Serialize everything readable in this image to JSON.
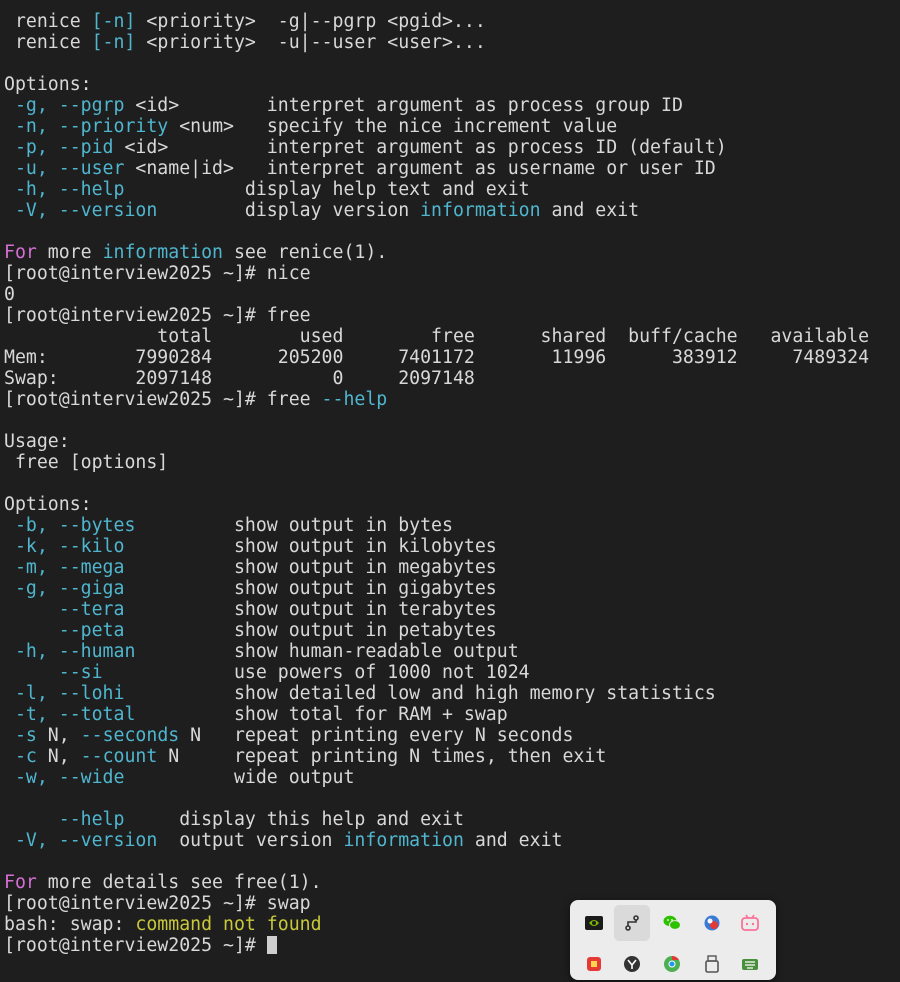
{
  "terminal": {
    "lines": [
      [
        {
          "t": " renice "
        },
        {
          "t": "[-n]",
          "c": "c"
        },
        {
          "t": " <priority>  -g|--pgrp <pgid>..."
        }
      ],
      [
        {
          "t": " renice "
        },
        {
          "t": "[-n]",
          "c": "c"
        },
        {
          "t": " <priority>  -u|--user <user>..."
        }
      ],
      [],
      [
        {
          "t": "Options:"
        }
      ],
      [
        {
          "t": " "
        },
        {
          "t": "-g, --pgrp",
          "c": "c"
        },
        {
          "t": " <id>        interpret argument as process group ID"
        }
      ],
      [
        {
          "t": " "
        },
        {
          "t": "-n, --priority",
          "c": "c"
        },
        {
          "t": " <num>   specify the nice increment value"
        }
      ],
      [
        {
          "t": " "
        },
        {
          "t": "-p, --pid",
          "c": "c"
        },
        {
          "t": " <id>         interpret argument as process ID (default)"
        }
      ],
      [
        {
          "t": " "
        },
        {
          "t": "-u, --user",
          "c": "c"
        },
        {
          "t": " <name|id>   interpret argument as username or user ID"
        }
      ],
      [
        {
          "t": " "
        },
        {
          "t": "-h, --help",
          "c": "c"
        },
        {
          "t": "           display help text and exit"
        }
      ],
      [
        {
          "t": " "
        },
        {
          "t": "-V, --version",
          "c": "c"
        },
        {
          "t": "        display version "
        },
        {
          "t": "information",
          "c": "c"
        },
        {
          "t": " and exit"
        }
      ],
      [],
      [
        {
          "t": "For",
          "c": "m"
        },
        {
          "t": " more "
        },
        {
          "t": "information",
          "c": "c"
        },
        {
          "t": " see renice(1)."
        }
      ],
      [
        {
          "t": "[root@interview2025 ~]# nice"
        }
      ],
      [
        {
          "t": "0"
        }
      ],
      [
        {
          "t": "[root@interview2025 ~]# free"
        }
      ],
      [
        {
          "t": "              total        used        free      shared  buff/cache   available"
        }
      ],
      [
        {
          "t": "Mem:        7990284      205200     7401172       11996      383912     7489324"
        }
      ],
      [
        {
          "t": "Swap:       2097148           0     2097148"
        }
      ],
      [
        {
          "t": "[root@interview2025 ~]# free "
        },
        {
          "t": "--help",
          "c": "c"
        }
      ],
      [],
      [
        {
          "t": "Usage:"
        }
      ],
      [
        {
          "t": " free [options]"
        }
      ],
      [],
      [
        {
          "t": "Options:"
        }
      ],
      [
        {
          "t": " "
        },
        {
          "t": "-b, --bytes",
          "c": "c"
        },
        {
          "t": "         show output in bytes"
        }
      ],
      [
        {
          "t": " "
        },
        {
          "t": "-k, --kilo",
          "c": "c"
        },
        {
          "t": "          show output in kilobytes"
        }
      ],
      [
        {
          "t": " "
        },
        {
          "t": "-m, --mega",
          "c": "c"
        },
        {
          "t": "          show output in megabytes"
        }
      ],
      [
        {
          "t": " "
        },
        {
          "t": "-g, --giga",
          "c": "c"
        },
        {
          "t": "          show output in gigabytes"
        }
      ],
      [
        {
          "t": "     "
        },
        {
          "t": "--tera",
          "c": "c"
        },
        {
          "t": "          show output in terabytes"
        }
      ],
      [
        {
          "t": "     "
        },
        {
          "t": "--peta",
          "c": "c"
        },
        {
          "t": "          show output in petabytes"
        }
      ],
      [
        {
          "t": " "
        },
        {
          "t": "-h, --human",
          "c": "c"
        },
        {
          "t": "         show human-readable output"
        }
      ],
      [
        {
          "t": "     "
        },
        {
          "t": "--si",
          "c": "c"
        },
        {
          "t": "            use powers of 1000 not 1024"
        }
      ],
      [
        {
          "t": " "
        },
        {
          "t": "-l, --lohi",
          "c": "c"
        },
        {
          "t": "          show detailed low and high memory statistics"
        }
      ],
      [
        {
          "t": " "
        },
        {
          "t": "-t, --total",
          "c": "c"
        },
        {
          "t": "         show total for RAM + swap"
        }
      ],
      [
        {
          "t": " "
        },
        {
          "t": "-s",
          "c": "c"
        },
        {
          "t": " N, "
        },
        {
          "t": "--seconds",
          "c": "c"
        },
        {
          "t": " N   repeat printing every N seconds"
        }
      ],
      [
        {
          "t": " "
        },
        {
          "t": "-c",
          "c": "c"
        },
        {
          "t": " N, "
        },
        {
          "t": "--count",
          "c": "c"
        },
        {
          "t": " N     repeat printing N times, then exit"
        }
      ],
      [
        {
          "t": " "
        },
        {
          "t": "-w, --wide",
          "c": "c"
        },
        {
          "t": "          wide output"
        }
      ],
      [],
      [
        {
          "t": "     "
        },
        {
          "t": "--help",
          "c": "c"
        },
        {
          "t": "     display this help and exit"
        }
      ],
      [
        {
          "t": " "
        },
        {
          "t": "-V, --version",
          "c": "c"
        },
        {
          "t": "  output version "
        },
        {
          "t": "information",
          "c": "c"
        },
        {
          "t": " and exit"
        }
      ],
      [],
      [
        {
          "t": "For",
          "c": "m"
        },
        {
          "t": " more details see free(1)."
        }
      ],
      [
        {
          "t": "[root@interview2025 ~]# swap"
        }
      ],
      [
        {
          "t": "bash: swap: "
        },
        {
          "t": "command not found",
          "c": "y"
        }
      ],
      [
        {
          "t": "[root@interview2025 ~]# "
        }
      ]
    ]
  },
  "colors": {
    "background": "#1e1e1e",
    "text": "#d8d8d8",
    "cyan": "#4fb6cf",
    "magenta": "#d56fd5",
    "yellow": "#c8c83a"
  },
  "tray": {
    "icons": [
      {
        "name": "nvidia-icon",
        "color": "#76b900"
      },
      {
        "name": "route-icon",
        "color": "#333333"
      },
      {
        "name": "wechat-icon",
        "color": "#2dc100"
      },
      {
        "name": "shield-app-icon",
        "color": "#3a7bd5"
      },
      {
        "name": "bilibili-icon",
        "color": "#fb7299"
      },
      {
        "name": "red-app-icon",
        "color": "#e53935"
      },
      {
        "name": "y-app-icon",
        "color": "#333333"
      },
      {
        "name": "chrome-icon",
        "color": "#4caf50"
      },
      {
        "name": "usb-drive-icon",
        "color": "#555555"
      },
      {
        "name": "keyboard-icon",
        "color": "#4a8f3c"
      }
    ]
  }
}
